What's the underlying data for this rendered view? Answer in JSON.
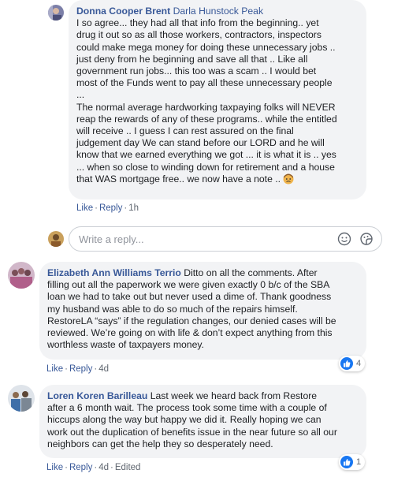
{
  "comment1": {
    "author": "Donna Cooper Brent",
    "tag": "Darla Hunstock Peak",
    "lines": [
      "I so agree... they had all that info from the beginning.. yet",
      "drug it out so as all those workers, contractors, inspectors",
      "could make mega money for doing these unnecessary jobs ..",
      "just deny from he beginning and save all that .. Like all",
      "government run jobs... this too was a scam .. I would bet",
      "most of the Funds went to pay all these unnecessary people",
      "...",
      "The normal average hardworking taxpaying folks will NEVER",
      "reap the rewards of any of these programs.. while the entitled",
      "will receive .. I guess I can rest assured on the final",
      "judgement day We can stand before our LORD and he will",
      "know that we earned everything we got ... it is what it is .. yes",
      "... when so close to winding down for retirement and a house",
      "that WAS mortgage free.. we now have a note .."
    ],
    "emoji": "worried-face-emoji",
    "actions": {
      "like": "Like",
      "reply": "Reply",
      "time": "1h"
    }
  },
  "reply_box": {
    "placeholder": "Write a reply...",
    "emoji_icon": "smiley-icon",
    "sticker_icon": "sticker-icon"
  },
  "comment2": {
    "author": "Elizabeth Ann Williams Terrio",
    "lines": [
      " Ditto on all the comments. After",
      "filling out all the paperwork we were given exactly 0 b/c of the SBA",
      "loan we had to take out but never used a dime of. Thank goodness",
      "my husband was able to do so much of the repairs himself.",
      "RestoreLA “says” if the regulation changes, our denied cases will be",
      "reviewed. We’re going on with life & don’t expect anything from this",
      "worthless waste of taxpayers money."
    ],
    "actions": {
      "like": "Like",
      "reply": "Reply",
      "time": "4d"
    },
    "reaction_count": "4"
  },
  "comment3": {
    "author": "Loren Koren Barilleau",
    "lines": [
      " Last week we heard back from Restore",
      "after a 6 month wait. The process took some time with a couple of",
      "hiccups along the way but happy we did it. Really hoping we can",
      "work out the duplication of benefits issue in the near future so all our",
      "neighbors can get the help they so desperately need."
    ],
    "actions": {
      "like": "Like",
      "reply": "Reply",
      "time": "4d",
      "edited": "Edited"
    },
    "reaction_count": "1"
  },
  "colors": {
    "link": "#385898",
    "bubble": "#f2f3f5",
    "meta": "#606770",
    "like_blue": "#1877f2"
  }
}
